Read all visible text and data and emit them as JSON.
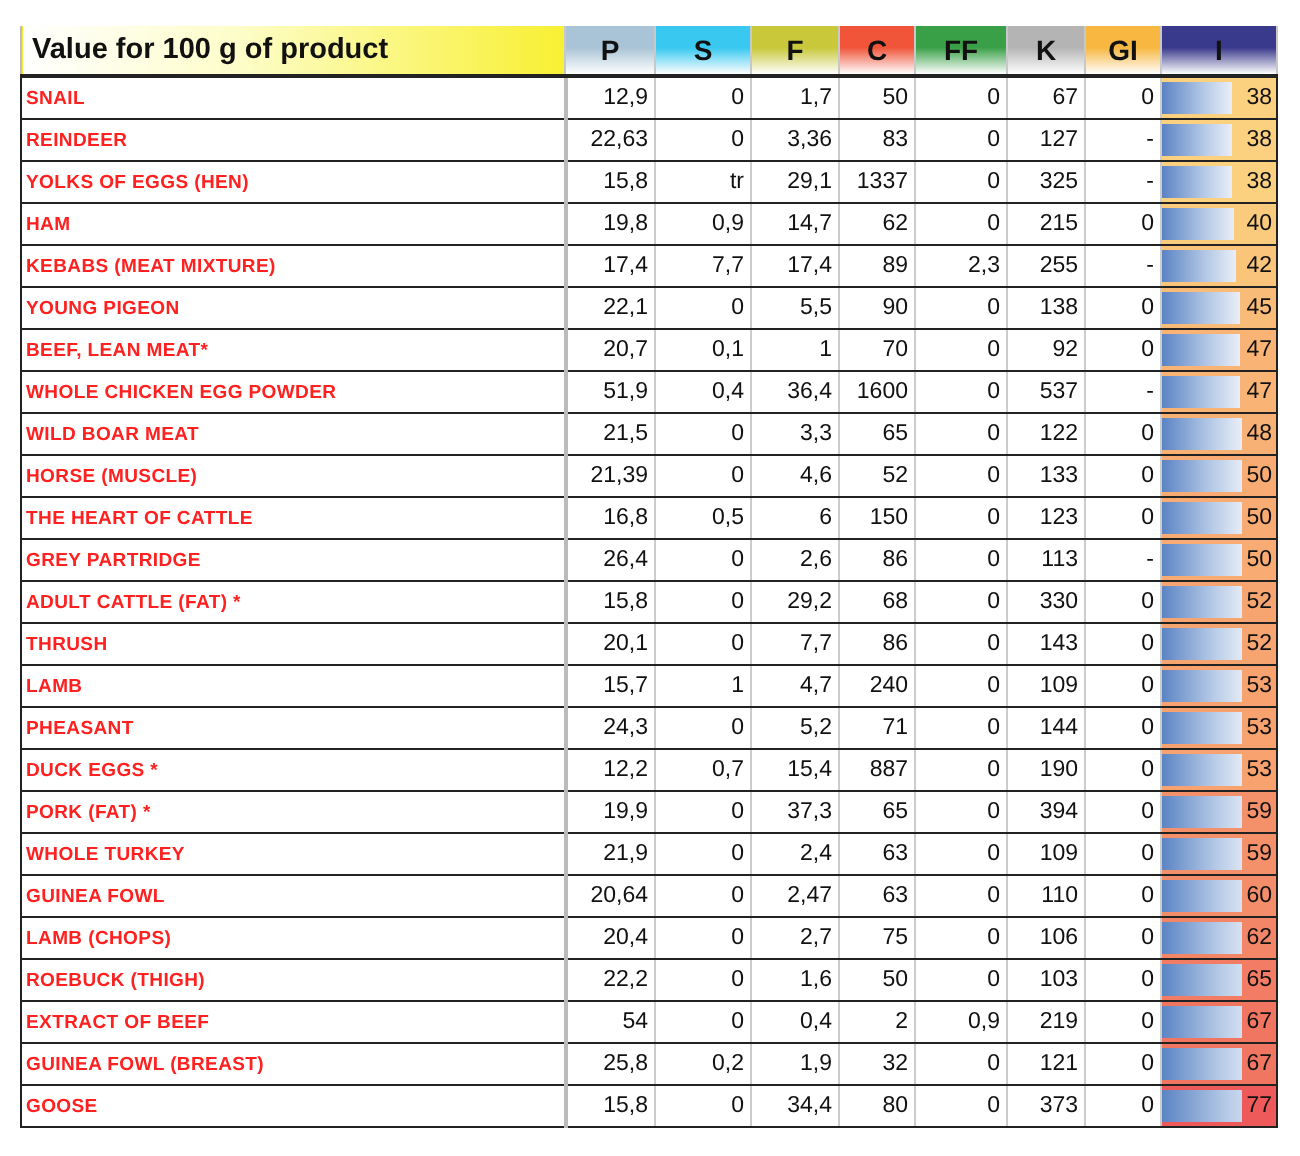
{
  "table": {
    "title": "Value for 100 g of product",
    "columns": [
      {
        "label": "P",
        "color": "#a9c4d6"
      },
      {
        "label": "S",
        "color": "#38c8f0"
      },
      {
        "label": "F",
        "color": "#c8c83a"
      },
      {
        "label": "C",
        "color": "#f0553a"
      },
      {
        "label": "FF",
        "color": "#3aa048"
      },
      {
        "label": "K",
        "color": "#b4b4b4"
      },
      {
        "label": "GI",
        "color": "#f7b740"
      },
      {
        "label": "I",
        "color": "#3a3a8c"
      }
    ],
    "rows": [
      {
        "name": "SNAIL",
        "cells": [
          "12,9",
          "0",
          "1,7",
          "50",
          "0",
          "67",
          "0"
        ],
        "index": "38",
        "level": 0.62,
        "color": "#fbd17f"
      },
      {
        "name": "REINDEER",
        "cells": [
          "22,63",
          "0",
          "3,36",
          "83",
          "0",
          "127",
          "-"
        ],
        "index": "38",
        "level": 0.62,
        "color": "#fbd17f"
      },
      {
        "name": "YOLKS OF EGGS (HEN)",
        "cells": [
          "15,8",
          "tr",
          "29,1",
          "1337",
          "0",
          "325",
          "-"
        ],
        "index": "38",
        "level": 0.62,
        "color": "#fbd17f"
      },
      {
        "name": "HAM",
        "cells": [
          "19,8",
          "0,9",
          "14,7",
          "62",
          "0",
          "215",
          "0"
        ],
        "index": "40",
        "level": 0.64,
        "color": "#fbcb7d"
      },
      {
        "name": "KEBABS (MEAT MIXTURE)",
        "cells": [
          "17,4",
          "7,7",
          "17,4",
          "89",
          "2,3",
          "255",
          "-"
        ],
        "index": "42",
        "level": 0.65,
        "color": "#fac57b"
      },
      {
        "name": "YOUNG PIGEON",
        "cells": [
          "22,1",
          "0",
          "5,5",
          "90",
          "0",
          "138",
          "0"
        ],
        "index": "45",
        "level": 0.68,
        "color": "#f9bc78"
      },
      {
        "name": "BEEF, LEAN MEAT*",
        "cells": [
          "20,7",
          "0,1",
          "1",
          "70",
          "0",
          "92",
          "0"
        ],
        "index": "47",
        "level": 0.69,
        "color": "#f9b475"
      },
      {
        "name": "WHOLE CHICKEN EGG POWDER",
        "cells": [
          "51,9",
          "0,4",
          "36,4",
          "1600",
          "0",
          "537",
          "-"
        ],
        "index": "47",
        "level": 0.69,
        "color": "#f9b475"
      },
      {
        "name": "WILD BOAR MEAT",
        "cells": [
          "21,5",
          "0",
          "3,3",
          "65",
          "0",
          "122",
          "0"
        ],
        "index": "48",
        "level": 0.7,
        "color": "#f8b174"
      },
      {
        "name": "HORSE (MUSCLE)",
        "cells": [
          "21,39",
          "0",
          "4,6",
          "52",
          "0",
          "133",
          "0"
        ],
        "index": "50",
        "level": 0.72,
        "color": "#f8ab72"
      },
      {
        "name": "THE HEART OF CATTLE",
        "cells": [
          "16,8",
          "0,5",
          "6",
          "150",
          "0",
          "123",
          "0"
        ],
        "index": "50",
        "level": 0.72,
        "color": "#f8ab72"
      },
      {
        "name": "GREY PARTRIDGE",
        "cells": [
          "26,4",
          "0",
          "2,6",
          "86",
          "0",
          "113",
          "-"
        ],
        "index": "50",
        "level": 0.72,
        "color": "#f8ab72"
      },
      {
        "name": "ADULT CATTLE (FAT) *",
        "cells": [
          "15,8",
          "0",
          "29,2",
          "68",
          "0",
          "330",
          "0"
        ],
        "index": "52",
        "level": 0.73,
        "color": "#f7a570"
      },
      {
        "name": "THRUSH",
        "cells": [
          "20,1",
          "0",
          "7,7",
          "86",
          "0",
          "143",
          "0"
        ],
        "index": "52",
        "level": 0.73,
        "color": "#f7a570"
      },
      {
        "name": "LAMB",
        "cells": [
          "15,7",
          "1",
          "4,7",
          "240",
          "0",
          "109",
          "0"
        ],
        "index": "53",
        "level": 0.74,
        "color": "#f7a26f"
      },
      {
        "name": "PHEASANT",
        "cells": [
          "24,3",
          "0",
          "5,2",
          "71",
          "0",
          "144",
          "0"
        ],
        "index": "53",
        "level": 0.74,
        "color": "#f7a26f"
      },
      {
        "name": "DUCK EGGS *",
        "cells": [
          "12,2",
          "0,7",
          "15,4",
          "887",
          "0",
          "190",
          "0"
        ],
        "index": "53",
        "level": 0.74,
        "color": "#f7a26f"
      },
      {
        "name": "PORK (FAT) *",
        "cells": [
          "19,9",
          "0",
          "37,3",
          "65",
          "0",
          "394",
          "0"
        ],
        "index": "59",
        "level": 0.79,
        "color": "#f4906a"
      },
      {
        "name": "WHOLE TURKEY",
        "cells": [
          "21,9",
          "0",
          "2,4",
          "63",
          "0",
          "109",
          "0"
        ],
        "index": "59",
        "level": 0.79,
        "color": "#f4906a"
      },
      {
        "name": "GUINEA FOWL",
        "cells": [
          "20,64",
          "0",
          "2,47",
          "63",
          "0",
          "110",
          "0"
        ],
        "index": "60",
        "level": 0.8,
        "color": "#f48d69"
      },
      {
        "name": "LAMB (CHOPS)",
        "cells": [
          "20,4",
          "0",
          "2,7",
          "75",
          "0",
          "106",
          "0"
        ],
        "index": "62",
        "level": 0.81,
        "color": "#f38667"
      },
      {
        "name": "ROEBUCK (THIGH)",
        "cells": [
          "22,2",
          "0",
          "1,6",
          "50",
          "0",
          "103",
          "0"
        ],
        "index": "65",
        "level": 0.84,
        "color": "#f27c64"
      },
      {
        "name": "EXTRACT OF BEEF",
        "cells": [
          "54",
          "0",
          "0,4",
          "2",
          "0,9",
          "219",
          "0"
        ],
        "index": "67",
        "level": 0.85,
        "color": "#f17661"
      },
      {
        "name": "GUINEA FOWL (BREAST)",
        "cells": [
          "25,8",
          "0,2",
          "1,9",
          "32",
          "0",
          "121",
          "0"
        ],
        "index": "67",
        "level": 0.85,
        "color": "#f17661"
      },
      {
        "name": "GOOSE",
        "cells": [
          "15,8",
          "0",
          "34,4",
          "80",
          "0",
          "373",
          "0"
        ],
        "index": "77",
        "level": 0.93,
        "color": "#ee5a59"
      }
    ]
  }
}
